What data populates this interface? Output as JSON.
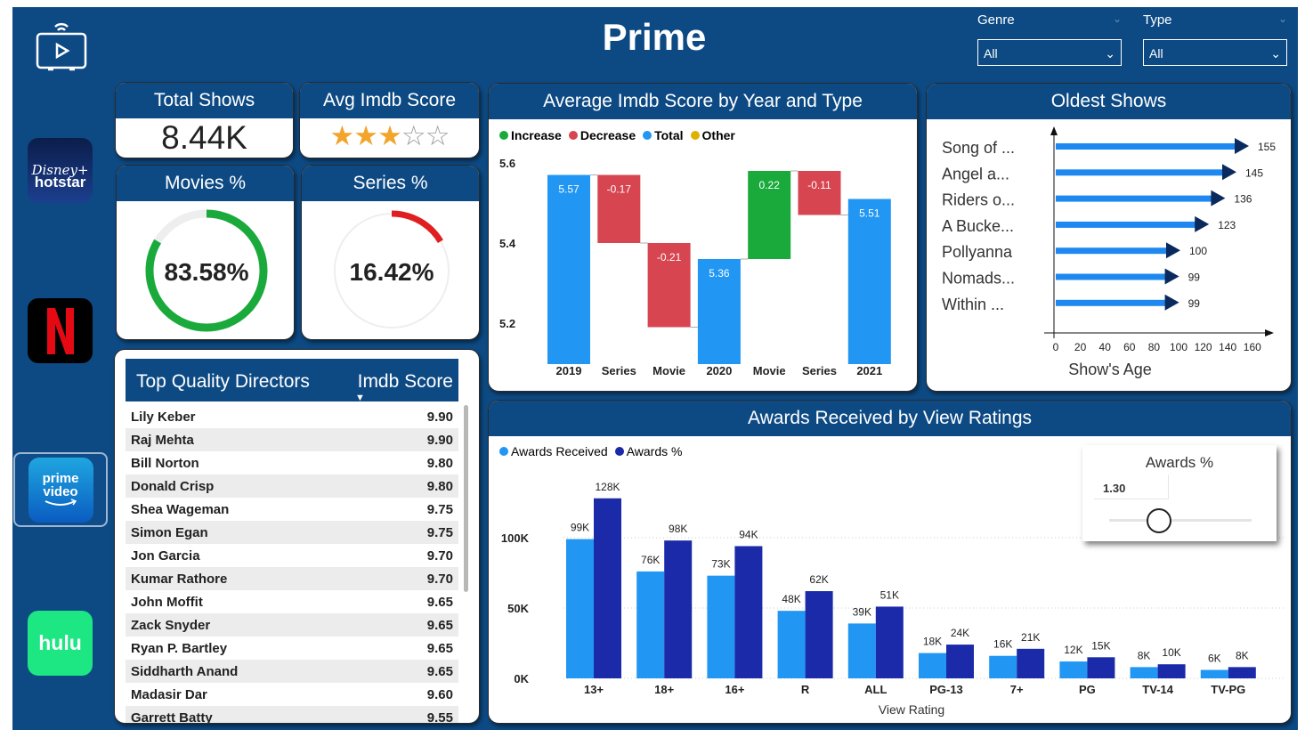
{
  "header": {
    "title": "Prime",
    "filters": [
      {
        "label": "Genre",
        "value": "All"
      },
      {
        "label": "Type",
        "value": "All"
      }
    ]
  },
  "sidebar": {
    "apps": [
      {
        "name": "disney-hotstar",
        "line1": "Disney+",
        "line2": "hotstar"
      },
      {
        "name": "netflix",
        "line1": "N"
      },
      {
        "name": "prime-video",
        "line1": "prime",
        "line2": "video"
      },
      {
        "name": "hulu",
        "line1": "hulu"
      }
    ]
  },
  "kpis": {
    "total_shows": {
      "title": "Total Shows",
      "value": "8.44K"
    },
    "avg_imdb": {
      "title": "Avg Imdb Score",
      "rating": 3,
      "max": 5
    },
    "movies": {
      "title": "Movies %",
      "value": "83.58%",
      "pct": 83.58,
      "color": "#1aaa3c"
    },
    "series": {
      "title": "Series %",
      "value": "16.42%",
      "pct": 16.42,
      "color": "#e02020"
    }
  },
  "directors": {
    "col1": "Top Quality Directors",
    "col2": "Imdb Score",
    "rows": [
      {
        "name": "Lily Keber",
        "score": "9.90"
      },
      {
        "name": "Raj Mehta",
        "score": "9.90"
      },
      {
        "name": "Bill Norton",
        "score": "9.80"
      },
      {
        "name": "Donald Crisp",
        "score": "9.80"
      },
      {
        "name": "Shea Wageman",
        "score": "9.75"
      },
      {
        "name": "Simon Egan",
        "score": "9.75"
      },
      {
        "name": "Jon Garcia",
        "score": "9.70"
      },
      {
        "name": "Kumar Rathore",
        "score": "9.70"
      },
      {
        "name": "John Moffit",
        "score": "9.65"
      },
      {
        "name": "Zack Snyder",
        "score": "9.65"
      },
      {
        "name": "Ryan P. Bartley",
        "score": "9.65"
      },
      {
        "name": "Siddharth Anand",
        "score": "9.65"
      },
      {
        "name": "Madasir Dar",
        "score": "9.60"
      },
      {
        "name": "Garrett Batty",
        "score": "9.55"
      }
    ]
  },
  "colors": {
    "increase": "#1aaa3c",
    "decrease": "#d64550",
    "total": "#2196f3",
    "other": "#e0b000",
    "awards_received": "#2196f3",
    "awards_pct": "#1a2aa8"
  },
  "chart_data": [
    {
      "type": "bar",
      "subtype": "waterfall",
      "title": "Average Imdb Score by Year and Type",
      "legend": [
        "Increase",
        "Decrease",
        "Total",
        "Other"
      ],
      "legend_position": "top-left",
      "categories": [
        "2019",
        "Series",
        "Movie",
        "2020",
        "Movie",
        "Series",
        "2021"
      ],
      "values": [
        5.57,
        -0.17,
        -0.21,
        5.36,
        0.22,
        -0.11,
        5.51
      ],
      "labels": [
        "5.57",
        "-0.17",
        "-0.21",
        "5.36",
        "0.22",
        "-0.11",
        "5.51"
      ],
      "kinds": [
        "total",
        "decrease",
        "decrease",
        "total",
        "increase",
        "decrease",
        "total"
      ],
      "ylim": [
        5.1,
        5.6
      ],
      "yticks": [
        "5.6",
        "5.4",
        "5.2"
      ],
      "yticks_values": [
        5.6,
        5.4,
        5.2
      ]
    },
    {
      "type": "bar",
      "orientation": "horizontal",
      "title": "Oldest Shows",
      "xlabel": "Show's Age",
      "categories": [
        "Song of ...",
        "Angel a...",
        "Riders o...",
        "A Bucke...",
        "Pollyanna",
        "Nomads...",
        "Within ..."
      ],
      "values": [
        155,
        145,
        136,
        123,
        100,
        99,
        99
      ],
      "xlim": [
        0,
        170
      ],
      "xticks": [
        0,
        20,
        40,
        60,
        80,
        100,
        120,
        140,
        160
      ]
    },
    {
      "type": "bar",
      "title": "Awards Received by View Ratings",
      "xlabel": "View Rating",
      "legend_position": "top-left",
      "categories": [
        "13+",
        "18+",
        "16+",
        "R",
        "ALL",
        "PG-13",
        "7+",
        "PG",
        "TV-14",
        "TV-PG"
      ],
      "series": [
        {
          "name": "Awards Received",
          "values": [
            99000,
            76000,
            73000,
            48000,
            39000,
            18000,
            16000,
            12000,
            8000,
            6000
          ],
          "labels": [
            "99K",
            "76K",
            "73K",
            "48K",
            "39K",
            "18K",
            "16K",
            "12K",
            "8K",
            "6K"
          ]
        },
        {
          "name": "Awards %",
          "values": [
            128000,
            98000,
            94000,
            62000,
            51000,
            24000,
            21000,
            15000,
            10000,
            8000
          ],
          "labels": [
            "128K",
            "98K",
            "94K",
            "62K",
            "51K",
            "24K",
            "21K",
            "15K",
            "10K",
            "8K"
          ]
        }
      ],
      "ylim": [
        0,
        140000
      ],
      "yticks": [
        "0K",
        "50K",
        "100K"
      ],
      "yticks_values": [
        0,
        50000,
        100000
      ]
    }
  ],
  "awards_slider": {
    "title": "Awards %",
    "value": "1.30",
    "position": 0.35
  }
}
